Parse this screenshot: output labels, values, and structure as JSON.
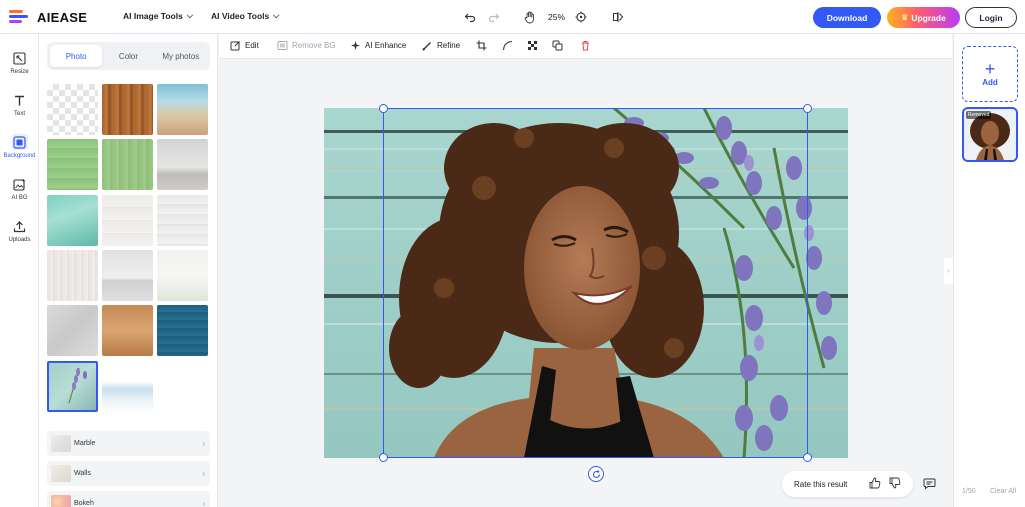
{
  "header": {
    "brand": "AIEASE",
    "menu_image": "AI Image Tools",
    "menu_video": "AI Video Tools",
    "zoom": "25%",
    "download_label": "Download",
    "upgrade_label": "Upgrade",
    "login_label": "Login",
    "icons": [
      "undo-icon",
      "redo-icon",
      "hand-icon",
      "crosshair-icon",
      "compare-icon"
    ]
  },
  "rail": {
    "items": [
      {
        "label": "Resize",
        "icon": "resize-icon"
      },
      {
        "label": "Text",
        "icon": "text-icon"
      },
      {
        "label": "Background",
        "icon": "background-icon",
        "active": true
      },
      {
        "label": "AI BG",
        "icon": "ai-bg-icon"
      },
      {
        "label": "Uploads",
        "icon": "upload-icon"
      }
    ]
  },
  "panel": {
    "tabs": [
      "Photo",
      "Color",
      "My photos"
    ],
    "active_tab": "Photo",
    "categories": [
      "Marble",
      "Walls",
      "Bokeh"
    ]
  },
  "toolbar": {
    "edit": "Edit",
    "remove_bg": "Remove BG",
    "ai_enhance": "AI Enhance",
    "refine": "Refine"
  },
  "canvas": {
    "rate_label": "Rate this result"
  },
  "history": {
    "add_label": "Add",
    "removed_badge": "Removed",
    "count": "1/50",
    "clear_label": "Clear All"
  },
  "colors": {
    "accent": "#3358f4",
    "upgrade_gradient_start": "#ffb21c",
    "upgrade_gradient_end": "#b83cf7"
  }
}
